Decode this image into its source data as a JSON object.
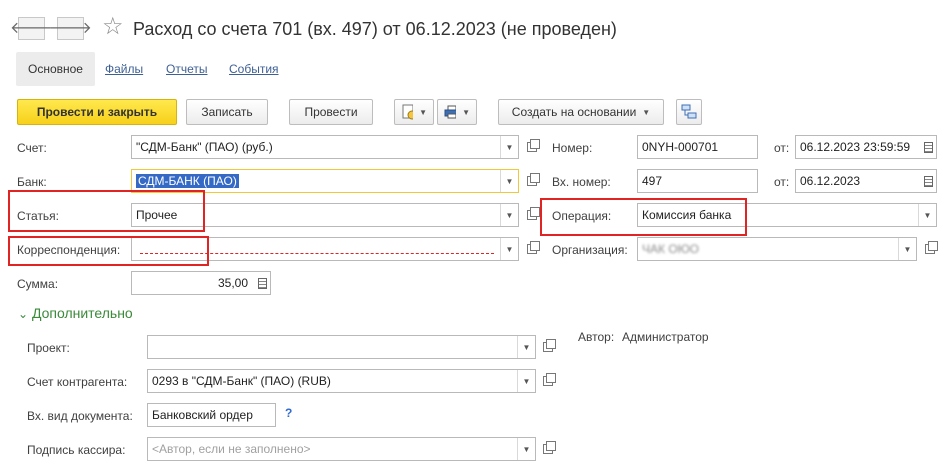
{
  "header": {
    "back_label": "🡐",
    "forward_label": "🡒",
    "star": "☆",
    "title": "Расход со счета 701 (вх. 497) от 06.12.2023 (не проведен)"
  },
  "tabs": [
    {
      "label": "Основное"
    },
    {
      "label": "Файлы"
    },
    {
      "label": "Отчеты"
    },
    {
      "label": "События"
    }
  ],
  "toolbar": {
    "post_close": "Провести и закрыть",
    "save": "Записать",
    "post": "Провести",
    "create_based": "Создать на основании"
  },
  "form": {
    "account_label": "Счет:",
    "account_value": "\"СДМ-Банк\" (ПАО) (руб.)",
    "bank_label": "Банк:",
    "bank_value": "СДМ-БАНК (ПАО)",
    "article_label": "Статья:",
    "article_value": "Прочее",
    "corr_label": "Корреспонденция:",
    "corr_value": "",
    "sum_label": "Сумма:",
    "sum_value": "35,00",
    "number_label": "Номер:",
    "number_value": "0NYH-000701",
    "from_label": "от:",
    "date_value": "06.12.2023 23:59:59",
    "in_number_label": "Вх. номер:",
    "in_number_value": "497",
    "in_from_label": "от:",
    "in_date_value": "06.12.2023",
    "operation_label": "Операция:",
    "operation_value": "Комиссия банка",
    "org_label": "Организация:",
    "org_value": "ЧАК ОЮО"
  },
  "additional": {
    "section_label": "Дополнительно",
    "author_label": "Автор:",
    "author_value": "Администратор",
    "project_label": "Проект:",
    "project_value": "",
    "counter_account_label": "Счет контрагента:",
    "counter_account_value": "0293 в \"СДМ-Банк\" (ПАО) (RUB)",
    "doc_type_label": "Вх. вид документа:",
    "doc_type_value": "Банковский ордер",
    "help": "?",
    "cashier_label": "Подпись кассира:",
    "cashier_placeholder": "<Автор, если не заполнено>"
  }
}
